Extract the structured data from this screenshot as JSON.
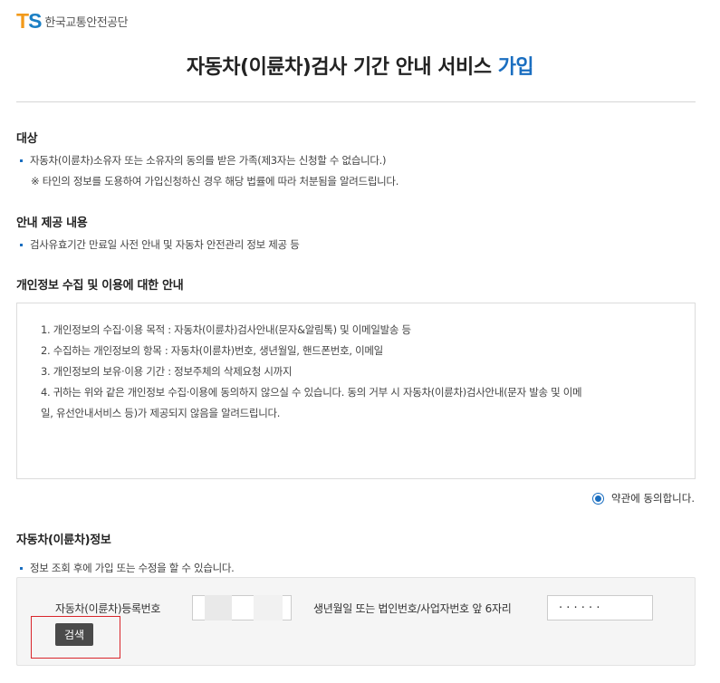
{
  "header": {
    "logo_t": "T",
    "logo_s": "S",
    "logo_text": "한국교통안전공단",
    "title_main": "자동차(이륜차)검사 기간 안내 서비스",
    "title_accent": "가입",
    "accent_color": "#1a6ec0"
  },
  "target": {
    "heading": "대상",
    "bullet": "자동차(이륜차)소유자 또는 소유자의 동의를 받은 가족(제3자는 신청할 수 없습니다.)",
    "note": "※ 타인의 정보를 도용하여 가입신청하신 경우 해당 법률에 따라 처분됨을 알려드립니다."
  },
  "content": {
    "heading": "안내 제공 내용",
    "bullet": "검사유효기간 만료일 사전 안내 및 자동차 안전관리 정보 제공 등"
  },
  "privacy": {
    "heading": "개인정보 수집 및 이용에 대한 안내",
    "lines": [
      "1. 개인정보의 수집·이용 목적 : 자동차(이륜차)검사안내(문자&알림톡) 및 이메일발송 등",
      "2. 수집하는 개인정보의 항목 : 자동차(이륜차)번호, 생년월일, 핸드폰번호, 이메일",
      "3. 개인정보의 보유·이용 기간 : 정보주체의 삭제요청 시까지",
      "4. 귀하는 위와 같은 개인정보 수집·이용에 동의하지 않으실 수 있습니다. 동의 거부 시 자동차(이륜차)검사안내(문자 발송 및 이메",
      "일, 유선안내서비스 등)가 제공되지 않음을 알려드립니다."
    ],
    "agree_label": "약관에 동의합니다.",
    "agree_checked": true
  },
  "vehicle": {
    "heading": "자동차(이륜차)정보",
    "bullet": "정보 조회 후에 가입 또는 수정을 할 수 있습니다.",
    "reg_label": "자동차(이륜차)등록번호",
    "birth_label": "생년월일 또는 법인번호/사업자번호 앞 6자리",
    "birth_value": "· · · · · ·",
    "search_label": "검색",
    "highlight_color": "#d9252b"
  }
}
